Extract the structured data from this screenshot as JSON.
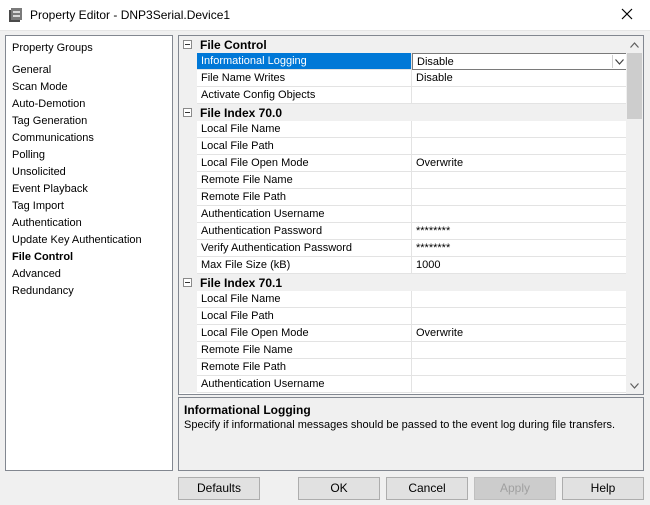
{
  "window": {
    "title": "Property Editor - DNP3Serial.Device1"
  },
  "icons": {
    "app": "property-editor-icon",
    "close": "close-icon",
    "dropdown": "chevron-down-icon",
    "scroll_up": "scroll-up-icon",
    "scroll_down": "scroll-down-icon"
  },
  "colors": {
    "selection": "#0078d7",
    "panel_bg": "#f0f0f0"
  },
  "property_groups": {
    "title": "Property Groups",
    "items": [
      {
        "label": "General"
      },
      {
        "label": "Scan Mode"
      },
      {
        "label": "Auto-Demotion"
      },
      {
        "label": "Tag Generation"
      },
      {
        "label": "Communications"
      },
      {
        "label": "Polling"
      },
      {
        "label": "Unsolicited"
      },
      {
        "label": "Event Playback"
      },
      {
        "label": "Tag Import"
      },
      {
        "label": "Authentication"
      },
      {
        "label": "Update Key Authentication"
      },
      {
        "label": "File Control",
        "selected": true
      },
      {
        "label": "Advanced"
      },
      {
        "label": "Redundancy"
      }
    ]
  },
  "grid": {
    "rows": [
      {
        "type": "section",
        "label": "File Control"
      },
      {
        "type": "prop",
        "name": "Informational Logging",
        "value": "Disable",
        "selected": true,
        "dropdown": true
      },
      {
        "type": "prop",
        "name": "File Name Writes",
        "value": "Disable"
      },
      {
        "type": "prop",
        "name": "Activate Config Objects",
        "value": ""
      },
      {
        "type": "section",
        "label": "File Index 70.0"
      },
      {
        "type": "prop",
        "name": "Local File Name",
        "value": ""
      },
      {
        "type": "prop",
        "name": "Local File Path",
        "value": ""
      },
      {
        "type": "prop",
        "name": "Local File Open Mode",
        "value": "Overwrite"
      },
      {
        "type": "prop",
        "name": "Remote File Name",
        "value": ""
      },
      {
        "type": "prop",
        "name": "Remote File Path",
        "value": ""
      },
      {
        "type": "prop",
        "name": "Authentication Username",
        "value": ""
      },
      {
        "type": "prop",
        "name": "Authentication Password",
        "value": "********"
      },
      {
        "type": "prop",
        "name": "Verify Authentication Password",
        "value": "********"
      },
      {
        "type": "prop",
        "name": "Max File Size (kB)",
        "value": "1000"
      },
      {
        "type": "section",
        "label": "File Index 70.1"
      },
      {
        "type": "prop",
        "name": "Local File Name",
        "value": ""
      },
      {
        "type": "prop",
        "name": "Local File Path",
        "value": ""
      },
      {
        "type": "prop",
        "name": "Local File Open Mode",
        "value": "Overwrite"
      },
      {
        "type": "prop",
        "name": "Remote File Name",
        "value": ""
      },
      {
        "type": "prop",
        "name": "Remote File Path",
        "value": ""
      },
      {
        "type": "prop",
        "name": "Authentication Username",
        "value": ""
      }
    ]
  },
  "description": {
    "title": "Informational Logging",
    "text": "Specify if informational messages should be passed to the event log during file transfers."
  },
  "buttons": {
    "defaults": "Defaults",
    "ok": "OK",
    "cancel": "Cancel",
    "apply": "Apply",
    "help": "Help"
  }
}
